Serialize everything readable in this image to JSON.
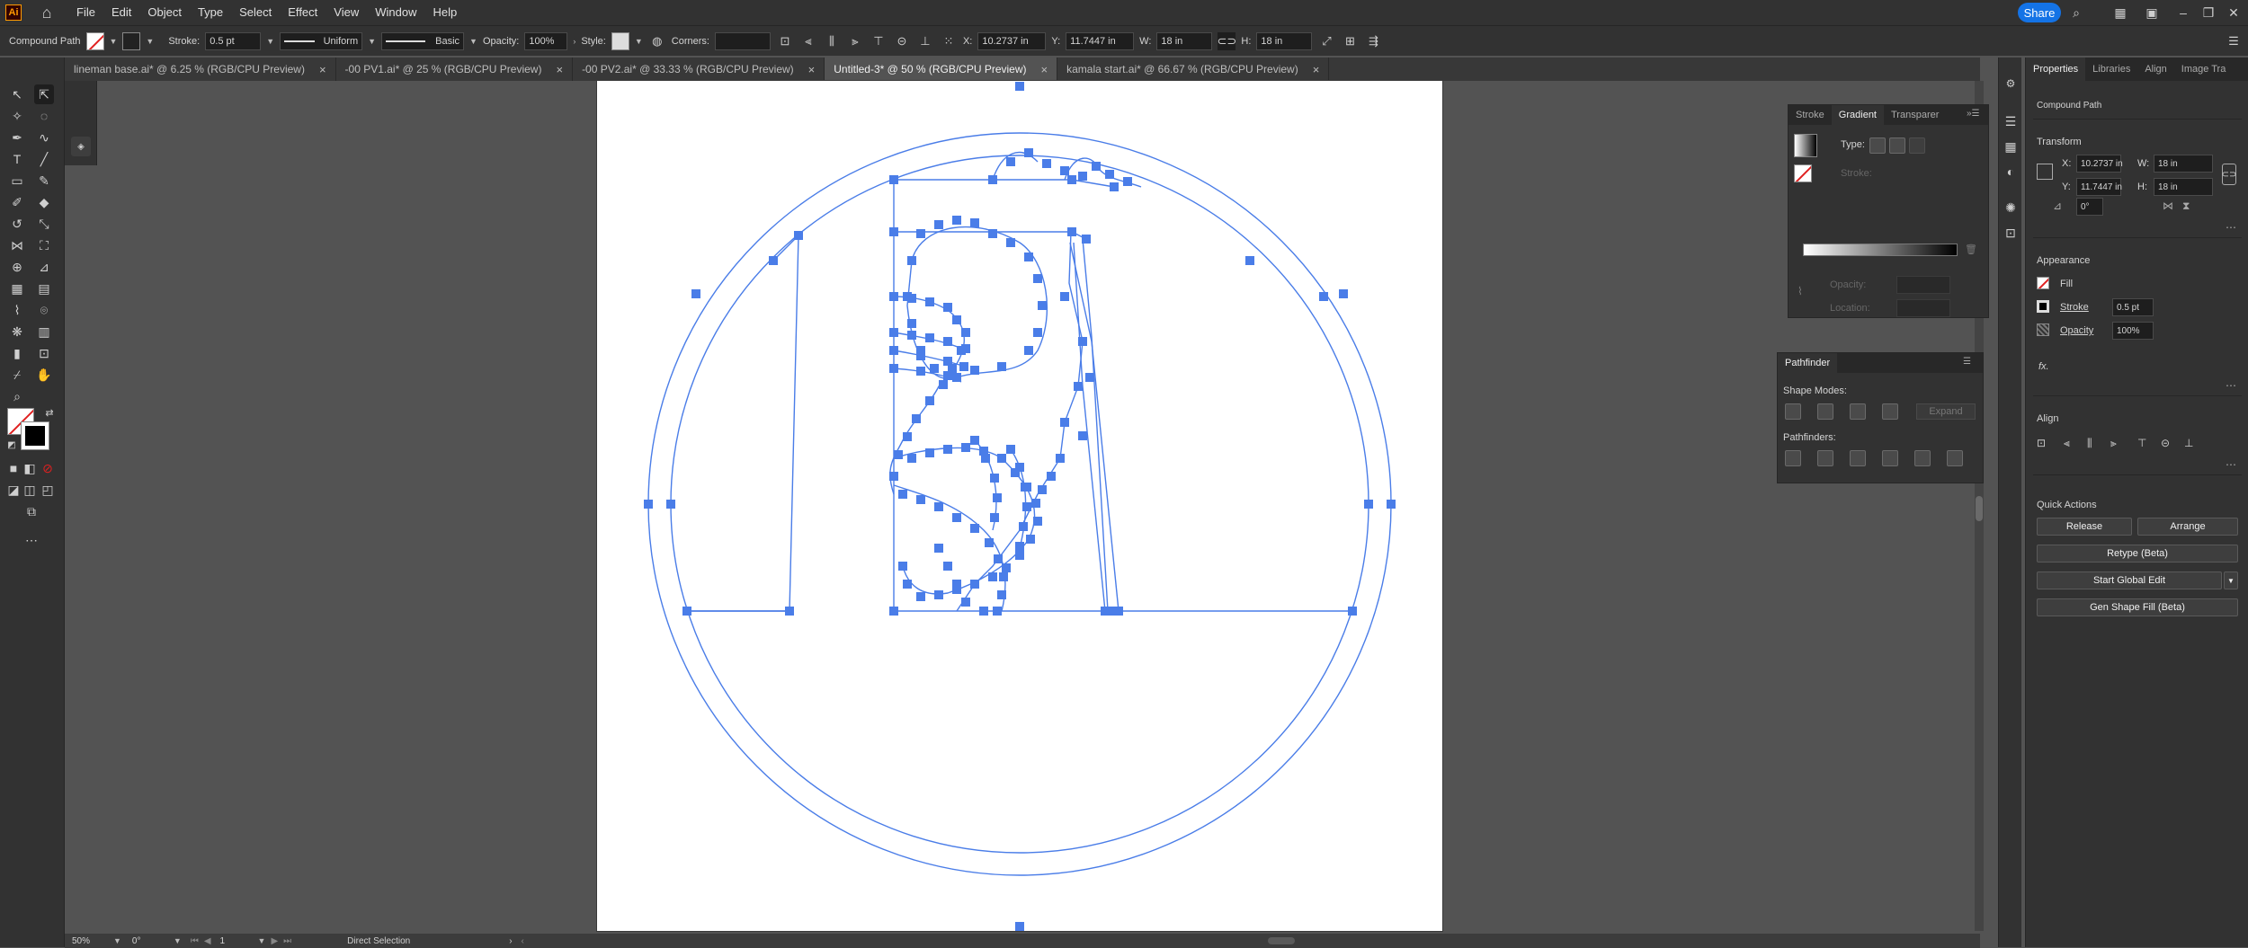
{
  "menubar": {
    "app_logo": "Ai",
    "items": [
      "File",
      "Edit",
      "Object",
      "Type",
      "Select",
      "Effect",
      "View",
      "Window",
      "Help"
    ],
    "share_label": "Share"
  },
  "control_bar": {
    "selection_type": "Compound Path",
    "stroke_label": "Stroke:",
    "stroke_weight": "0.5 pt",
    "profile_label": "Uniform",
    "brush_label": "Basic",
    "opacity_label": "Opacity:",
    "opacity_value": "100%",
    "style_label": "Style:",
    "corners_label": "Corners:",
    "x_label": "X:",
    "x_value": "10.2737 in",
    "y_label": "Y:",
    "y_value": "11.7447 in",
    "w_label": "W:",
    "w_value": "18 in",
    "h_label": "H:",
    "h_value": "18 in"
  },
  "tabs": [
    {
      "label": "lineman base.ai* @ 6.25 % (RGB/CPU Preview)",
      "active": false
    },
    {
      "label": "-00 PV1.ai* @ 25 % (RGB/CPU Preview)",
      "active": false
    },
    {
      "label": "-00 PV2.ai* @ 33.33 % (RGB/CPU Preview)",
      "active": false
    },
    {
      "label": "Untitled-3* @ 50 % (RGB/CPU Preview)",
      "active": true
    },
    {
      "label": "kamala start.ai* @ 66.67 % (RGB/CPU Preview)",
      "active": false
    }
  ],
  "status_bar": {
    "zoom": "50%",
    "rotation": "0°",
    "artboard": "1",
    "tool": "Direct Selection"
  },
  "gradient_panel": {
    "tabs": [
      "Stroke",
      "Gradient",
      "Transparer"
    ],
    "type_label": "Type:",
    "stroke_label": "Stroke:",
    "opacity_label": "Opacity:",
    "location_label": "Location:"
  },
  "pathfinder_panel": {
    "title": "Pathfinder",
    "shape_modes_label": "Shape Modes:",
    "expand_label": "Expand",
    "pathfinders_label": "Pathfinders:"
  },
  "properties_panel": {
    "tabs": [
      "Properties",
      "Libraries",
      "Align",
      "Image Tra"
    ],
    "object_type": "Compound Path",
    "transform_title": "Transform",
    "x_label": "X:",
    "x_value": "10.2737 in",
    "y_label": "Y:",
    "y_value": "11.7447 in",
    "w_label": "W:",
    "w_value": "18 in",
    "h_label": "H:",
    "h_value": "18 in",
    "angle_value": "0°",
    "appearance_title": "Appearance",
    "fill_label": "Fill",
    "stroke_label": "Stroke",
    "stroke_value": "0.5 pt",
    "opacity_label": "Opacity",
    "opacity_value": "100%",
    "fx_label": "fx.",
    "align_title": "Align",
    "quick_actions_title": "Quick Actions",
    "release_label": "Release",
    "arrange_label": "Arrange",
    "retype_label": "Retype (Beta)",
    "global_edit_label": "Start Global Edit",
    "gen_shape_fill_label": "Gen Shape Fill (Beta)"
  },
  "colors": {
    "selection": "#4a7de8",
    "accent": "#1473e6"
  }
}
